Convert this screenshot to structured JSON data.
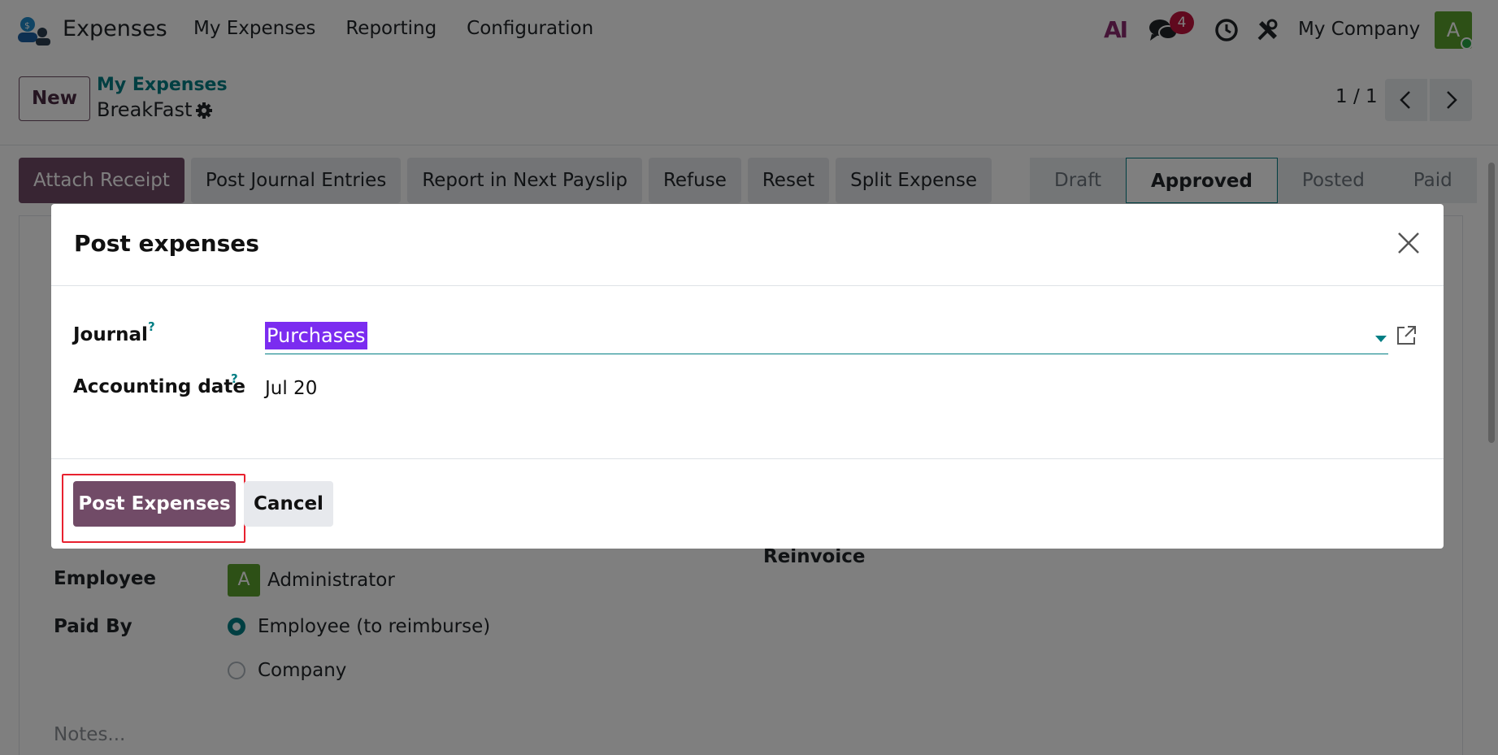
{
  "navbar": {
    "app_name": "Expenses",
    "menu": [
      "My Expenses",
      "Reporting",
      "Configuration"
    ],
    "ai_label": "AI",
    "chat_badge": "4",
    "company": "My Company",
    "avatar_letter": "A"
  },
  "control": {
    "new_label": "New",
    "breadcrumb_parent": "My Expenses",
    "breadcrumb_current": "BreakFast",
    "pager": "1 / 1"
  },
  "actions": [
    "Attach Receipt",
    "Post Journal Entries",
    "Report in Next Payslip",
    "Refuse",
    "Reset",
    "Split Expense"
  ],
  "statusbar": {
    "stages": [
      "Draft",
      "Approved",
      "Posted",
      "Paid"
    ],
    "active": "Approved"
  },
  "form": {
    "employee_label": "Employee",
    "employee_avatar": "A",
    "employee_value": "Administrator",
    "paid_by_label": "Paid By",
    "paid_by_options": [
      "Employee (to reimburse)",
      "Company"
    ],
    "paid_by_selected": "Employee (to reimburse)",
    "reinvoice_label": "Reinvoice",
    "notes_placeholder": "Notes..."
  },
  "modal": {
    "title": "Post expenses",
    "journal_label": "Journal",
    "journal_value": "Purchases",
    "accounting_date_label": "Accounting date",
    "accounting_date_value": "Jul 20",
    "help_mark": "?",
    "post_button": "Post Expenses",
    "cancel_button": "Cancel"
  },
  "colors": {
    "primary": "#714b67",
    "accent": "#017e84",
    "selection": "#7b2cf0",
    "badge": "#c0123c",
    "highlight": "#e8212f"
  }
}
